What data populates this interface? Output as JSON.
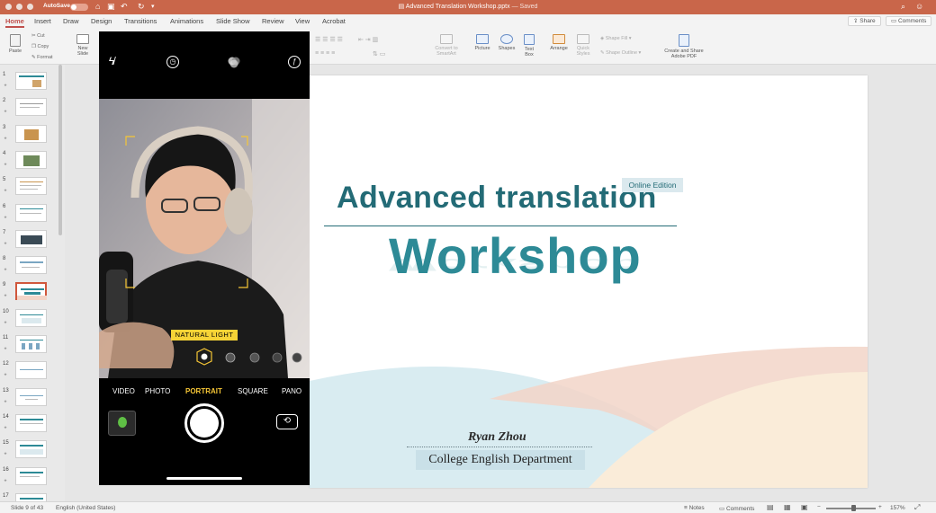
{
  "titlebar": {
    "autosave_label": "AutoSave",
    "autosave_state": "OFF",
    "file_title": "Advanced Translation Workshop.pptx",
    "saved_status": "— Saved"
  },
  "tabs": [
    {
      "label": "Home",
      "active": true
    },
    {
      "label": "Insert"
    },
    {
      "label": "Draw"
    },
    {
      "label": "Design"
    },
    {
      "label": "Transitions"
    },
    {
      "label": "Animations"
    },
    {
      "label": "Slide Show"
    },
    {
      "label": "Review"
    },
    {
      "label": "View"
    },
    {
      "label": "Acrobat"
    }
  ],
  "tab_actions": {
    "share": "Share",
    "comments": "Comments"
  },
  "ribbon": {
    "paste": "Paste",
    "cut": "Cut",
    "copy": "Copy",
    "format": "Format",
    "new_slide": "New Slide",
    "convert_smartart": "Convert to SmartArt",
    "picture": "Picture",
    "shapes": "Shapes",
    "text_box": "Text Box",
    "arrange": "Arrange",
    "quick_styles": "Quick Styles",
    "shape_fill": "Shape Fill",
    "shape_outline": "Shape Outline",
    "create_share_pdf": "Create and Share Adobe PDF"
  },
  "thumbnails": {
    "numbers": [
      "1",
      "2",
      "3",
      "4",
      "5",
      "6",
      "7",
      "8",
      "9",
      "10",
      "11",
      "12",
      "13",
      "14",
      "15",
      "16",
      "17"
    ],
    "selected_index": 8
  },
  "camera": {
    "mode_label": "NATURAL LIGHT",
    "modes": [
      "VIDEO",
      "PHOTO",
      "PORTRAIT",
      "SQUARE",
      "PANO"
    ],
    "active_mode": "PORTRAIT"
  },
  "slide": {
    "title_line1": "Advanced translation",
    "badge": "Online Edition",
    "title_line2": "Workshop",
    "author": "Ryan Zhou",
    "department": "College English Department"
  },
  "statusbar": {
    "slide_info": "Slide 9 of 43",
    "language": "English (United States)",
    "notes": "Notes",
    "comments": "Comments",
    "zoom": "157%"
  },
  "colors": {
    "title_bar": "#c9664a",
    "accent_tab": "#c0504d",
    "slide_title": "#236b76",
    "badge_bg": "#dbe9ee",
    "camera_accent": "#f6c636"
  }
}
